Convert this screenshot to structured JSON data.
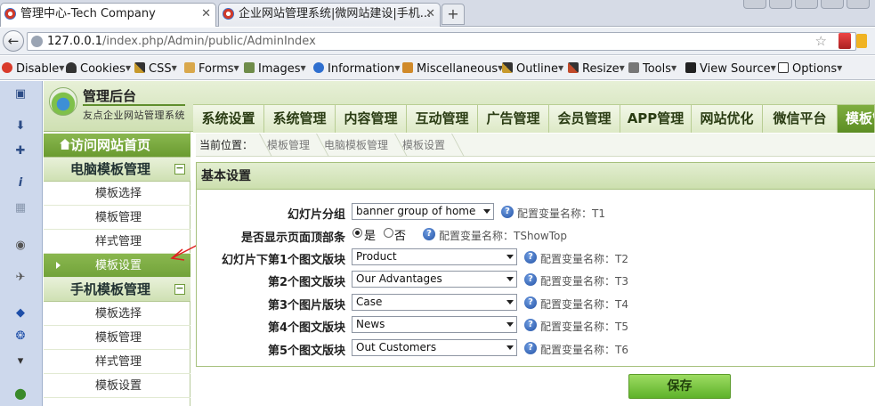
{
  "browser": {
    "tabs": [
      {
        "title": "管理中心-Tech Company",
        "active": true
      },
      {
        "title": "企业网站管理系统|微网站建设|手机...",
        "active": false
      }
    ],
    "new_tab": "+",
    "url_host": "127.0.0.1",
    "url_path": "/index.php/Admin/public/AdminIndex"
  },
  "devtoolbar": {
    "items": [
      "Disable",
      "Cookies",
      "CSS",
      "Forms",
      "Images",
      "Information",
      "Miscellaneous",
      "Outline",
      "Resize",
      "Tools",
      "View Source",
      "Options"
    ]
  },
  "header": {
    "logo_title": "管理后台",
    "logo_subtitle": "友点企业网站管理系统",
    "nav": [
      "系统设置",
      "系统管理",
      "内容管理",
      "互动管理",
      "广告管理",
      "会员管理",
      "APP管理",
      "网站优化",
      "微信平台",
      "模板管"
    ],
    "active_nav": "模板管"
  },
  "sidebar": {
    "home": "访问网站首页",
    "groups": [
      {
        "title": "电脑模板管理",
        "collapse": "−",
        "items": [
          "模板选择",
          "模板管理",
          "样式管理",
          "模板设置"
        ],
        "active": "模板设置"
      },
      {
        "title": "手机模板管理",
        "collapse": "−",
        "items": [
          "模板选择",
          "模板管理",
          "样式管理",
          "模板设置"
        ]
      }
    ]
  },
  "breadcrumb": {
    "label": "当前位置：",
    "items": [
      "模板管理",
      "电脑模板管理",
      "模板设置"
    ]
  },
  "panel": {
    "title": "基本设置",
    "help_glyph": "?",
    "rows": [
      {
        "label": "幻灯片分组",
        "value": "banner group of home",
        "hint": "配置变量名称：T1"
      },
      {
        "label": "是否显示页面顶部条",
        "radios": [
          {
            "label": "是",
            "checked": true
          },
          {
            "label": "否",
            "checked": false
          }
        ],
        "hint": "配置变量名称：TShowTop"
      },
      {
        "label": "幻灯片下第1个图文版块",
        "value": "Product",
        "hint": "配置变量名称：T2"
      },
      {
        "label": "第2个图文版块",
        "value": "Our Advantages",
        "hint": "配置变量名称：T3"
      },
      {
        "label": "第3个图片版块",
        "value": "Case",
        "hint": "配置变量名称：T4"
      },
      {
        "label": "第4个图文版块",
        "value": "News",
        "hint": "配置变量名称：T5"
      },
      {
        "label": "第5个图文版块",
        "value": "Out Customers",
        "hint": "配置变量名称：T6"
      }
    ],
    "save_label": "保存"
  },
  "colors": {
    "accent": "#6a9b30",
    "header_bg": "#dde9c6",
    "arrow": "#e02020"
  }
}
